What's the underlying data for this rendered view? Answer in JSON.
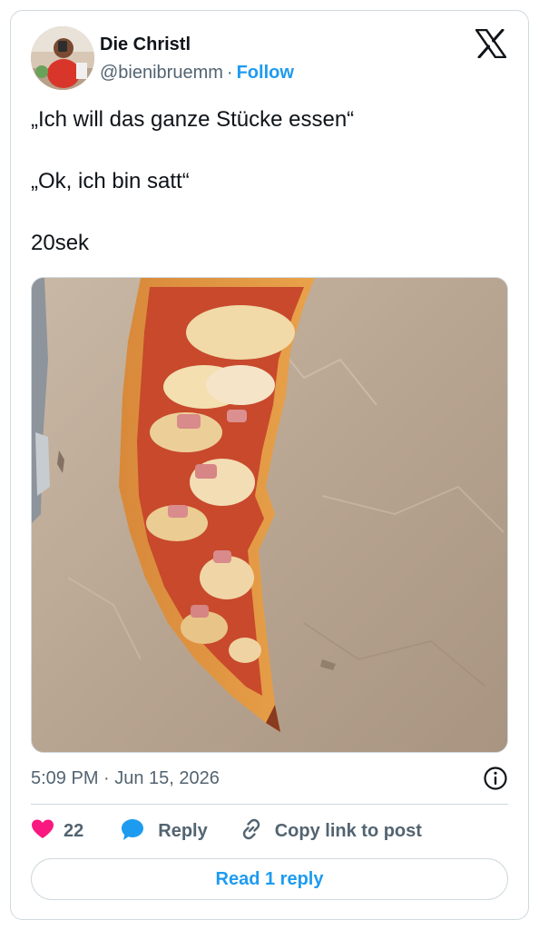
{
  "author": {
    "name": "Die Christl",
    "handle": "@bienibruemm",
    "separator": "·",
    "follow_label": "Follow"
  },
  "tweet": {
    "lines": [
      "„Ich will das ganze Stücke essen“",
      "„Ok, ich bin satt“",
      "20sek"
    ],
    "timestamp": "5:09 PM · Jun 15, 2026"
  },
  "actions": {
    "likes_count": "22",
    "reply_label": "Reply",
    "copy_link_label": "Copy link to post"
  },
  "read_replies_label": "Read 1 reply",
  "colors": {
    "accent": "#1d9bf0",
    "like": "#f91880",
    "muted": "#536471",
    "border": "#cfd9de"
  },
  "icons": [
    "x-logo-icon",
    "info-icon",
    "heart-icon",
    "reply-bubble-icon",
    "link-icon"
  ]
}
